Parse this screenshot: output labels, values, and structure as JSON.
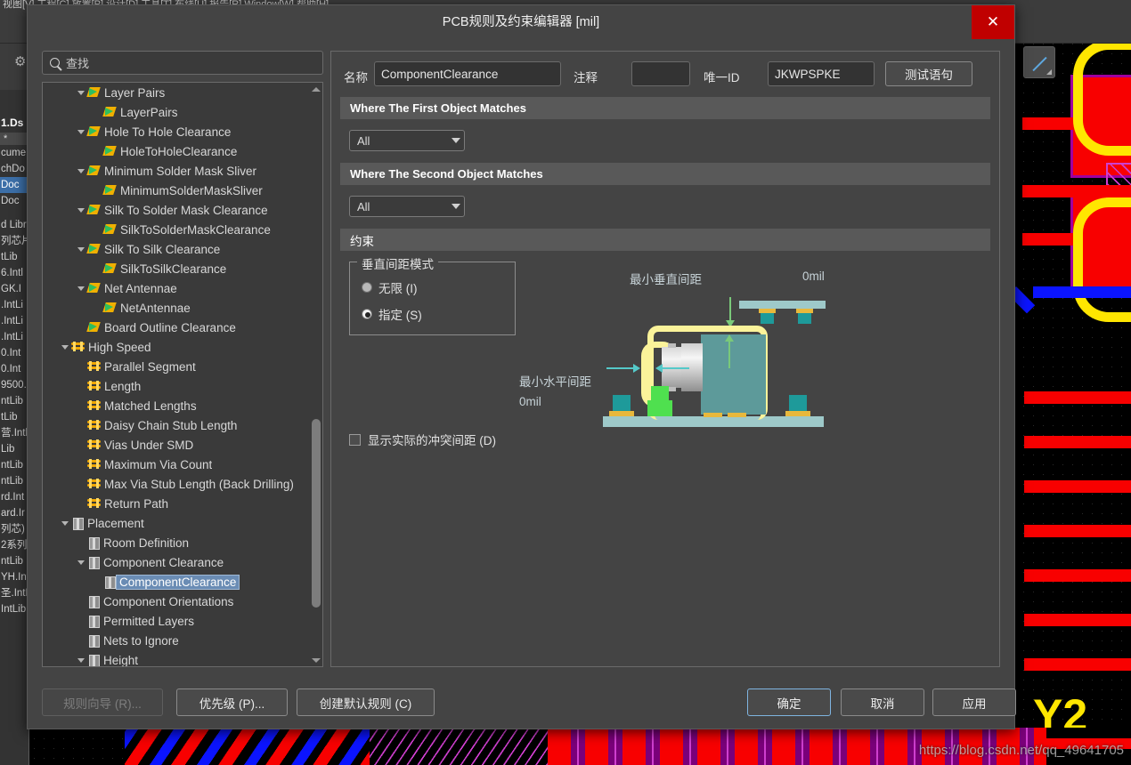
{
  "background": {
    "menubar_text": "视图[V]  工程[C]  放置[P]  设计[D]  工具[T]  布线[U]  报告[R]  Window[W]  帮助[H]",
    "gear_icon": "gear-icon",
    "project_panel": {
      "title": "1.Ds",
      "starred": "*",
      "rows": [
        "cume",
        "chDo",
        "Doc",
        "Doc",
        "",
        "d Libr",
        "列芯片",
        "tLib",
        "6.Intl",
        "GK.I",
        ".IntLi",
        ".IntLi",
        ".IntLi",
        "0.Int",
        "0.Int",
        "9500.",
        "ntLib",
        "tLib",
        "营.Intl",
        "Lib",
        "ntLib",
        "ntLib",
        "rd.Int",
        "ard.Ir",
        "列芯)",
        "2系列",
        "ntLib",
        "YH.Int",
        "圣.IntLib",
        "IntLib"
      ],
      "selected_index": 2
    },
    "big_label": "Y2",
    "watermark": "https://blog.csdn.net/qq_49641705",
    "mini_tool_icon": "line-tool-icon"
  },
  "dialog": {
    "title": "PCB规则及约束编辑器 [mil]",
    "close_label": "✕",
    "search": {
      "placeholder": "查找",
      "value": "",
      "icon": "search-icon"
    },
    "tree": [
      {
        "label": "Layer Pairs",
        "indent": 2,
        "icon": "rule-icon",
        "expander": "down"
      },
      {
        "label": "LayerPairs",
        "indent": 3,
        "icon": "rule-icon",
        "expander": "none"
      },
      {
        "label": "Hole To Hole Clearance",
        "indent": 2,
        "icon": "rule-icon",
        "expander": "down"
      },
      {
        "label": "HoleToHoleClearance",
        "indent": 3,
        "icon": "rule-icon",
        "expander": "none"
      },
      {
        "label": "Minimum Solder Mask Sliver",
        "indent": 2,
        "icon": "rule-icon",
        "expander": "down"
      },
      {
        "label": "MinimumSolderMaskSliver",
        "indent": 3,
        "icon": "rule-icon",
        "expander": "none"
      },
      {
        "label": "Silk To Solder Mask Clearance",
        "indent": 2,
        "icon": "rule-icon",
        "expander": "down"
      },
      {
        "label": "SilkToSolderMaskClearance",
        "indent": 3,
        "icon": "rule-icon",
        "expander": "none"
      },
      {
        "label": "Silk To Silk Clearance",
        "indent": 2,
        "icon": "rule-icon",
        "expander": "down"
      },
      {
        "label": "SilkToSilkClearance",
        "indent": 3,
        "icon": "rule-icon",
        "expander": "none"
      },
      {
        "label": "Net Antennae",
        "indent": 2,
        "icon": "rule-icon",
        "expander": "down"
      },
      {
        "label": "NetAntennae",
        "indent": 3,
        "icon": "rule-icon",
        "expander": "none"
      },
      {
        "label": "Board Outline Clearance",
        "indent": 2,
        "icon": "rule-icon",
        "expander": "none"
      },
      {
        "label": "High Speed",
        "indent": 1,
        "icon": "highspeed-icon",
        "expander": "down"
      },
      {
        "label": "Parallel Segment",
        "indent": 2,
        "icon": "highspeed-icon",
        "expander": "none"
      },
      {
        "label": "Length",
        "indent": 2,
        "icon": "highspeed-icon",
        "expander": "none"
      },
      {
        "label": "Matched Lengths",
        "indent": 2,
        "icon": "highspeed-icon",
        "expander": "none"
      },
      {
        "label": "Daisy Chain Stub Length",
        "indent": 2,
        "icon": "highspeed-icon",
        "expander": "none"
      },
      {
        "label": "Vias Under SMD",
        "indent": 2,
        "icon": "highspeed-icon",
        "expander": "none"
      },
      {
        "label": "Maximum Via Count",
        "indent": 2,
        "icon": "highspeed-icon",
        "expander": "none"
      },
      {
        "label": "Max Via Stub Length (Back Drilling)",
        "indent": 2,
        "icon": "highspeed-icon",
        "expander": "none"
      },
      {
        "label": "Return Path",
        "indent": 2,
        "icon": "highspeed-icon",
        "expander": "none"
      },
      {
        "label": "Placement",
        "indent": 1,
        "icon": "placement-icon",
        "expander": "down"
      },
      {
        "label": "Room Definition",
        "indent": 2,
        "icon": "placement-icon",
        "expander": "none"
      },
      {
        "label": "Component Clearance",
        "indent": 2,
        "icon": "placement-icon",
        "expander": "down"
      },
      {
        "label": "ComponentClearance",
        "indent": 3,
        "icon": "placement-icon",
        "expander": "none",
        "selected": true
      },
      {
        "label": "Component Orientations",
        "indent": 2,
        "icon": "placement-icon",
        "expander": "none"
      },
      {
        "label": "Permitted Layers",
        "indent": 2,
        "icon": "placement-icon",
        "expander": "none"
      },
      {
        "label": "Nets to Ignore",
        "indent": 2,
        "icon": "placement-icon",
        "expander": "none"
      },
      {
        "label": "Height",
        "indent": 2,
        "icon": "placement-icon",
        "expander": "down"
      }
    ],
    "form": {
      "name_label": "名称",
      "name_value": "ComponentClearance",
      "comment_label": "注释",
      "comment_value": "",
      "uid_label": "唯一ID",
      "uid_value": "JKWPSPKE",
      "test_query_label": "测试语句"
    },
    "first_object": {
      "header": "Where The First Object Matches",
      "scope_value": "All"
    },
    "second_object": {
      "header": "Where The Second Object Matches",
      "scope_value": "All"
    },
    "constraints": {
      "header": "约束",
      "vertical_mode_group": "垂直间距模式",
      "option_infinite": "无限 (I)",
      "option_infinite_key": "I",
      "option_specified": "指定 (S)",
      "option_specified_key": "S",
      "selected_option": "specified",
      "min_vertical_label": "最小垂直间距",
      "min_vertical_value": "0mil",
      "min_horizontal_label": "最小水平间距",
      "min_horizontal_value": "0mil",
      "show_actual_label": "显示实际的冲突间距 (D)",
      "show_actual_key": "D",
      "show_actual_checked": false
    },
    "footer": {
      "rule_wizard": "规则向导 (R)...",
      "rule_wizard_disabled": true,
      "priority": "优先级 (P)...",
      "create_default": "创建默认规则 (C)",
      "ok": "确定",
      "cancel": "取消",
      "apply": "应用"
    }
  },
  "colors": {
    "dialog_bg": "#444444",
    "section_bar": "#595959",
    "selection": "#6a8cb4",
    "close_red": "#c00000",
    "default_btn_border": "#7fb4e0",
    "trace_red": "#f80000",
    "trace_blue": "#0b14ff",
    "trace_yellow": "#ffe600",
    "pad_purple": "#a000a0"
  }
}
